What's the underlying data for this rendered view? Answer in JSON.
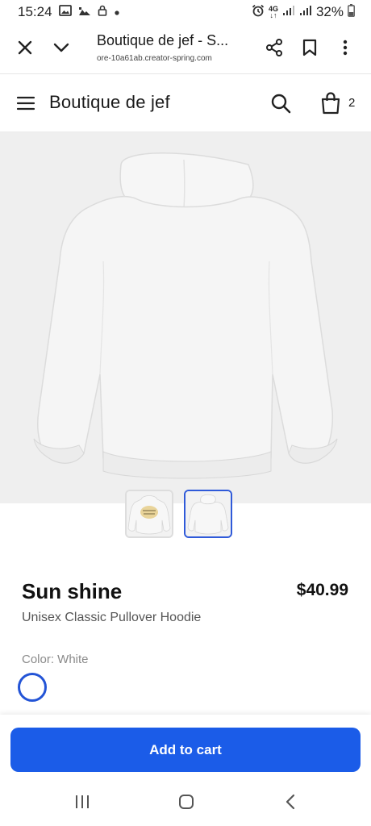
{
  "status_bar": {
    "time": "15:24",
    "network": "4G",
    "network_sub": "↓↑",
    "battery": "32%"
  },
  "browser": {
    "title": "Boutique de jef - S...",
    "url": "ore-10a61ab.creator-spring.com"
  },
  "store": {
    "name": "Boutique de jef",
    "cart_count": "2"
  },
  "product": {
    "name": "Sun shine",
    "price": "$40.99",
    "subtitle": "Unisex Classic Pullover Hoodie",
    "color_label": "Color: White",
    "selected_thumbnail": 2,
    "add_to_cart_label": "Add to cart"
  },
  "colors": {
    "accent": "#1b5ce8",
    "swatch_border": "#2354d6",
    "image_bg": "#efefef"
  },
  "icons": {
    "close": "close-icon",
    "collapse": "chevron-down-icon",
    "share": "share-icon",
    "bookmark": "bookmark-icon",
    "more": "more-vertical-icon",
    "menu": "menu-icon",
    "search": "search-icon",
    "bag": "shopping-bag-icon"
  }
}
